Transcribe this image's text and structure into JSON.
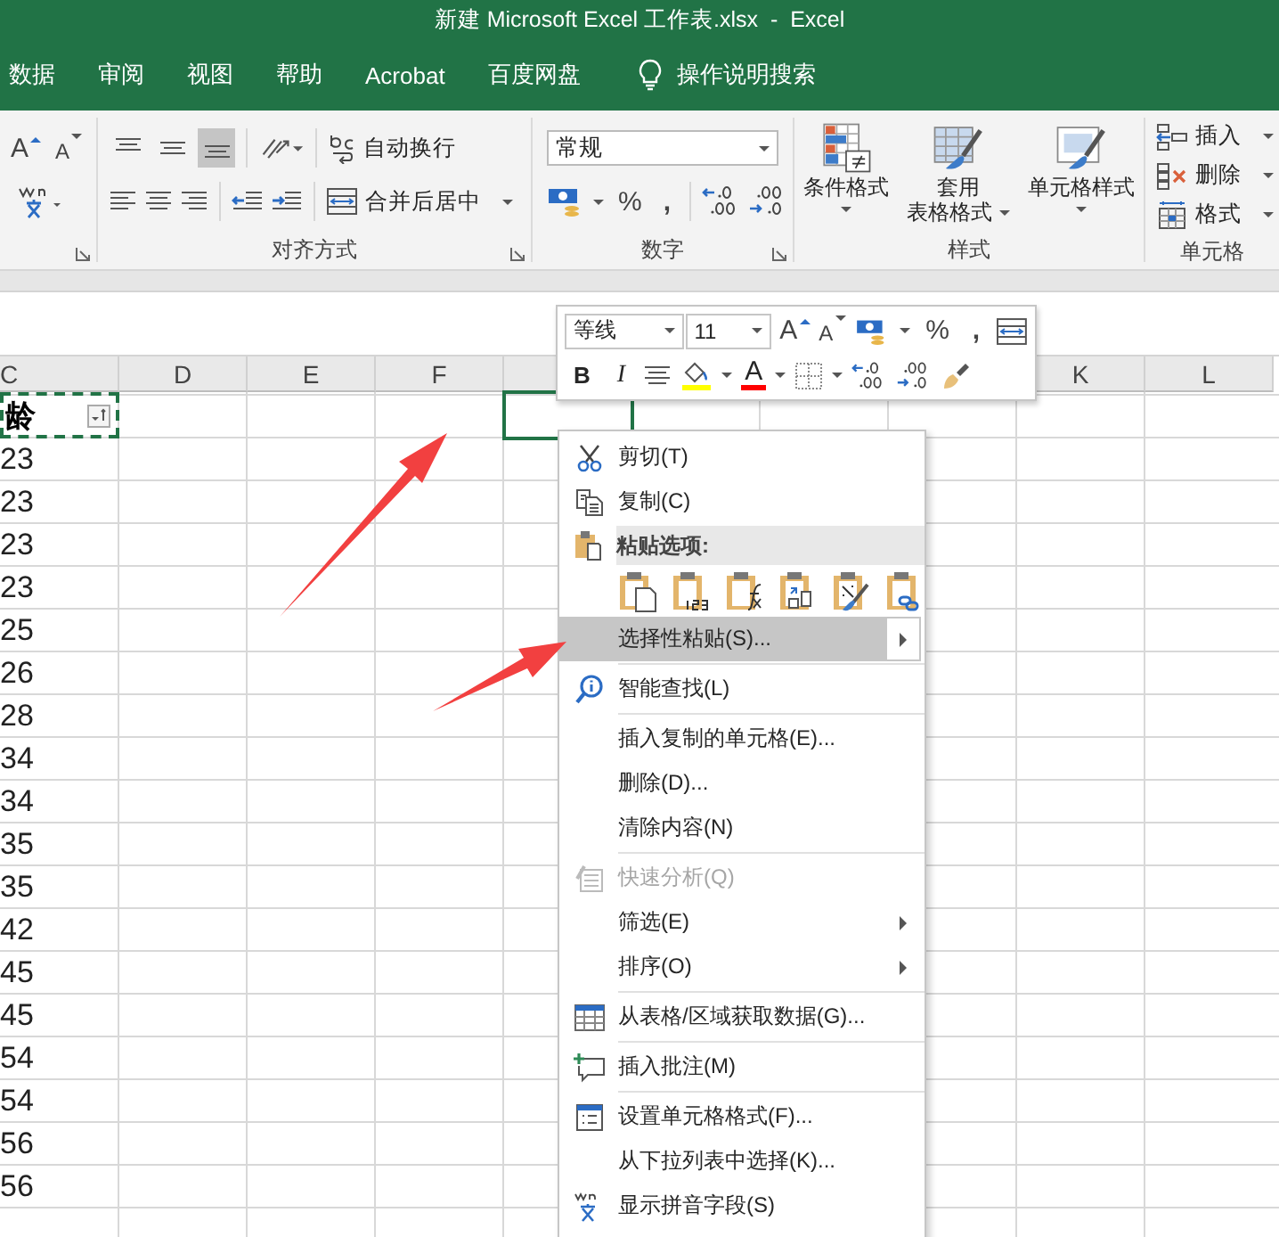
{
  "window": {
    "title": "新建 Microsoft Excel 工作表.xlsx  -  Excel"
  },
  "ribbon_tabs": [
    {
      "label": "数据"
    },
    {
      "label": "审阅"
    },
    {
      "label": "视图"
    },
    {
      "label": "帮助"
    },
    {
      "label": "Acrobat"
    },
    {
      "label": "百度网盘"
    }
  ],
  "tell_me": {
    "label": "操作说明搜索"
  },
  "font_group": {
    "grow": "A",
    "shrink": "A"
  },
  "alignment_group": {
    "label": "对齐方式",
    "vertical_align": [
      {
        "kind": "top",
        "on": false
      },
      {
        "kind": "middle",
        "on": false
      },
      {
        "kind": "bottom",
        "on": true
      }
    ],
    "wrap_text": "自动换行",
    "merge_center": "合并后居中"
  },
  "number_group": {
    "label": "数字",
    "format": "常规",
    "percent": "%",
    "comma": ","
  },
  "styles_group": {
    "label": "样式",
    "buttons": [
      {
        "kind": "conditional",
        "lines": [
          "条件格式"
        ]
      },
      {
        "kind": "table",
        "lines": [
          "套用",
          "表格格式"
        ]
      },
      {
        "kind": "cell",
        "lines": [
          "单元格样式"
        ]
      }
    ]
  },
  "cells_group": {
    "label": "单元格",
    "buttons": [
      {
        "kind": "insert",
        "label": "插入"
      },
      {
        "kind": "delete",
        "label": "删除"
      },
      {
        "kind": "format",
        "label": "格式"
      }
    ]
  },
  "sheet": {
    "columns": [
      "C",
      "D",
      "E",
      "F",
      null,
      null,
      null,
      null,
      "K",
      "L"
    ],
    "header_cell": {
      "text": "龄",
      "filter": true,
      "copied": true
    },
    "active_cell": {
      "visible": true
    },
    "values": [
      "23",
      "23",
      "23",
      "23",
      "25",
      "26",
      "28",
      "34",
      "34",
      "35",
      "35",
      "42",
      "45",
      "45",
      "54",
      "54",
      "56",
      "56"
    ]
  },
  "mini_toolbar": {
    "font": "等线",
    "size": "11",
    "grow": "A",
    "shrink": "A",
    "percent": "%",
    "comma": ",",
    "bold": "B",
    "italic": "I",
    "font_color": "A"
  },
  "context_menu": [
    {
      "kind": "cut",
      "label": "剪切(T)",
      "disabled": false,
      "selected": false,
      "submenu": false
    },
    {
      "kind": "copy",
      "label": "复制(C)",
      "disabled": false,
      "selected": false,
      "submenu": false
    },
    {
      "kind": "header",
      "label": "粘贴选项:"
    },
    {
      "kind": "paste-icons"
    },
    {
      "kind": "plain",
      "label": "选择性粘贴(S)...",
      "disabled": false,
      "selected": true,
      "submenu": true
    },
    {
      "kind": "separator"
    },
    {
      "kind": "lookup",
      "label": "智能查找(L)",
      "disabled": false,
      "selected": false,
      "submenu": false
    },
    {
      "kind": "separator"
    },
    {
      "kind": "plain",
      "label": "插入复制的单元格(E)...",
      "disabled": false,
      "selected": false,
      "submenu": false
    },
    {
      "kind": "plain",
      "label": "删除(D)...",
      "disabled": false,
      "selected": false,
      "submenu": false
    },
    {
      "kind": "plain",
      "label": "清除内容(N)",
      "disabled": false,
      "selected": false,
      "submenu": false
    },
    {
      "kind": "separator"
    },
    {
      "kind": "analysis",
      "label": "快速分析(Q)",
      "disabled": true,
      "selected": false,
      "submenu": false
    },
    {
      "kind": "plain",
      "label": "筛选(E)",
      "disabled": false,
      "selected": false,
      "submenu": true
    },
    {
      "kind": "plain",
      "label": "排序(O)",
      "disabled": false,
      "selected": false,
      "submenu": true
    },
    {
      "kind": "separator"
    },
    {
      "kind": "table",
      "label": "从表格/区域获取数据(G)...",
      "disabled": false,
      "selected": false,
      "submenu": false
    },
    {
      "kind": "separator"
    },
    {
      "kind": "comment",
      "label": "插入批注(M)",
      "disabled": false,
      "selected": false,
      "submenu": false
    },
    {
      "kind": "separator"
    },
    {
      "kind": "format",
      "label": "设置单元格格式(F)...",
      "disabled": false,
      "selected": false,
      "submenu": false
    },
    {
      "kind": "plain",
      "label": "从下拉列表中选择(K)...",
      "disabled": false,
      "selected": false,
      "submenu": false
    },
    {
      "kind": "phonetic",
      "label": "显示拼音字段(S)",
      "disabled": false,
      "selected": false,
      "submenu": false
    }
  ]
}
